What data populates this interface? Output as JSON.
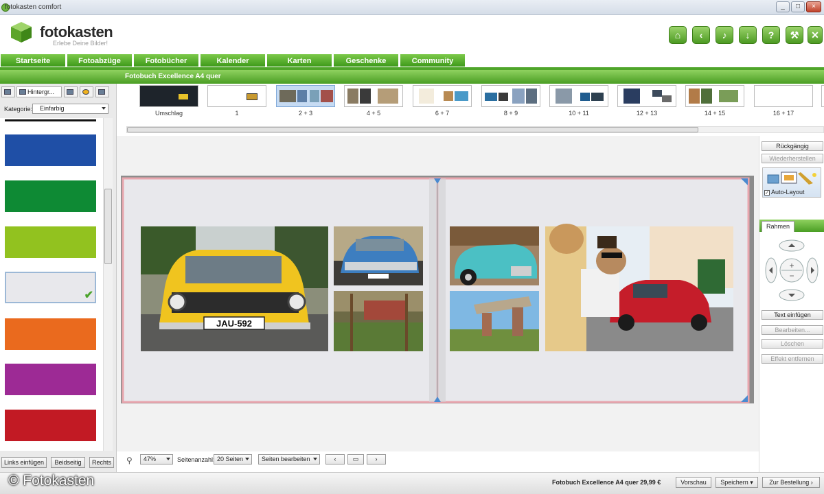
{
  "window": {
    "title": "fotokasten comfort"
  },
  "brand": {
    "name": "fotokasten",
    "tagline": "Erlebe Deine Bilder!"
  },
  "header_buttons": [
    "home-icon",
    "back-icon",
    "music-icon",
    "download-icon",
    "help-icon",
    "tools-icon",
    "close-icon"
  ],
  "nav": {
    "tabs": [
      "Startseite",
      "Fotoabzüge",
      "Fotobücher",
      "Kalender",
      "Karten",
      "Geschenke",
      "Community"
    ]
  },
  "left_panel": {
    "tabs": [
      "",
      "Hintergr...",
      "",
      "",
      ""
    ],
    "category_label": "Kategorie:",
    "category_value": "Einfarbig",
    "swatches": [
      {
        "color": "#1f4fa6",
        "selected": false
      },
      {
        "color": "#0e8a34",
        "selected": false
      },
      {
        "color": "#92c21f",
        "selected": false
      },
      {
        "color": "#e8e8ec",
        "selected": true
      },
      {
        "color": "#ea6a1e",
        "selected": false
      },
      {
        "color": "#9d2a95",
        "selected": false
      },
      {
        "color": "#c21a24",
        "selected": false
      }
    ],
    "buttons": {
      "left": "Links einfügen",
      "both": "Beidseitig",
      "right": "Rechts"
    }
  },
  "book": {
    "title": "Fotobuch Excellence A4 quer",
    "pages": [
      "Umschlag",
      "1",
      "2 + 3",
      "4 + 5",
      "6 + 7",
      "8 + 9",
      "10 + 11",
      "12 + 13",
      "14 + 15",
      "16 + 17"
    ],
    "selected_page": "2 + 3"
  },
  "tools": {
    "undo": "Rückgängig",
    "redo": "Wiederherstellen",
    "auto_layout": "Auto-Layout",
    "frame_tab": "Rahmen",
    "insert_text": "Text einfügen",
    "edit": "Bearbeiten...",
    "delete": "Löschen",
    "remove_effect": "Effekt entfernen"
  },
  "zoom": {
    "value": "47%",
    "pages_label": "Seitenanzahl:",
    "pages_value": "20 Seiten",
    "edit_pages": "Seiten bearbeiten"
  },
  "footer": {
    "copyright": "© Fotokasten",
    "price": "Fotobuch Excellence A4 quer 29,99 €",
    "preview": "Vorschau",
    "save": "Speichern",
    "order": "Zur Bestellung"
  },
  "colors": {
    "accent_green": "#4fa52a",
    "page_frame": "#e8a6ae",
    "page_fill": "#e8e8ec"
  }
}
